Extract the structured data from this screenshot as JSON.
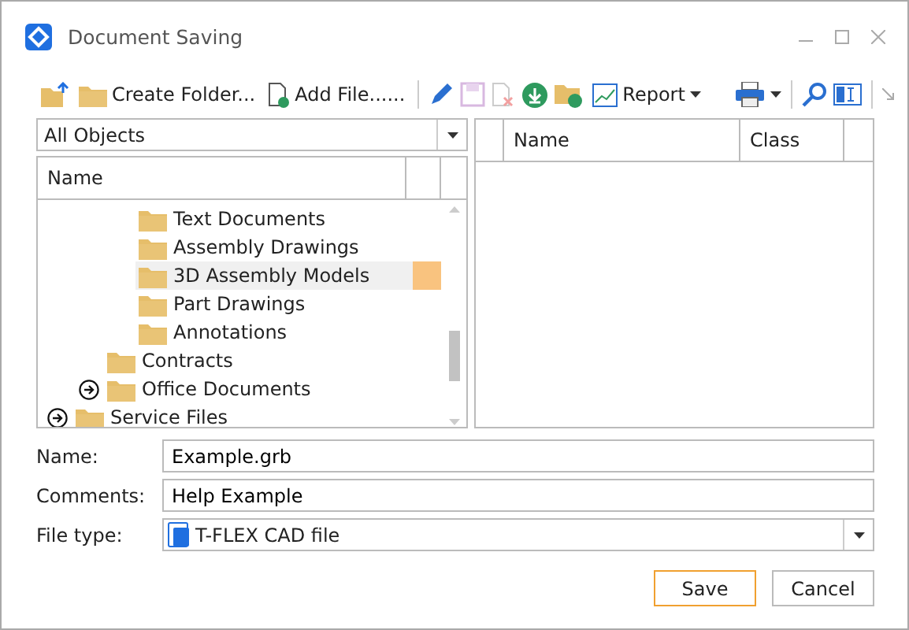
{
  "window": {
    "title": "Document Saving"
  },
  "toolbar": {
    "create_folder": "Create Folder...",
    "add_file": "Add File......",
    "report": "Report"
  },
  "filter": {
    "value": "All Objects"
  },
  "tree": {
    "column": "Name",
    "items": [
      {
        "children": [
          {
            "children": [
              {
                "name": "Text Documents",
                "selected": false,
                "expandable": false
              },
              {
                "name": "Assembly Drawings",
                "selected": false,
                "expandable": false
              },
              {
                "name": "3D Assembly Models",
                "selected": true,
                "expandable": false
              },
              {
                "name": "Part Drawings",
                "selected": false,
                "expandable": false
              },
              {
                "name": "Annotations",
                "selected": false,
                "expandable": false
              }
            ]
          },
          {
            "name": "Contracts",
            "selected": false,
            "expandable": false
          },
          {
            "name": "Office Documents",
            "selected": false,
            "expandable": true
          }
        ]
      },
      {
        "name": "Service Files",
        "selected": false,
        "expandable": true
      }
    ]
  },
  "table": {
    "columns": [
      "Name",
      "Class"
    ]
  },
  "form": {
    "name_label": "Name:",
    "name_value": "Example.grb",
    "comments_label": "Comments:",
    "comments_value": "Help Example",
    "type_label": "File type:",
    "type_value": "T-FLEX CAD file"
  },
  "buttons": [
    {
      "label": "Save",
      "default": true
    },
    {
      "label": "Cancel",
      "default": false
    }
  ]
}
